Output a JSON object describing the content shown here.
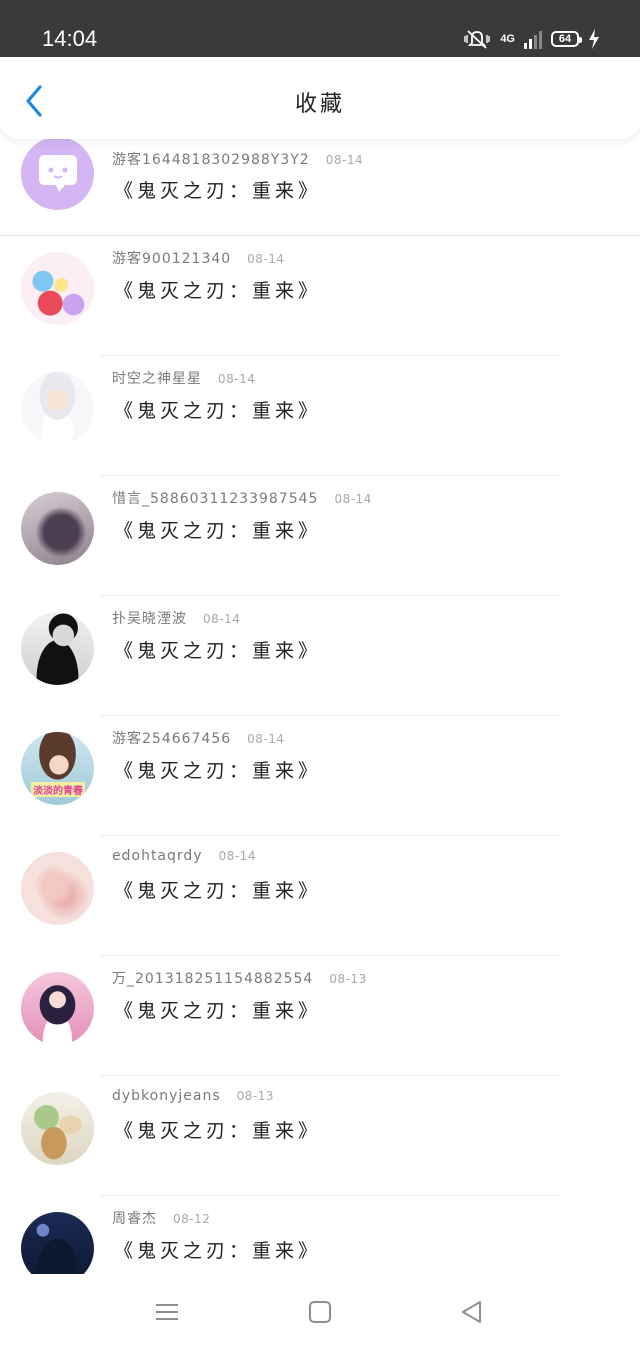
{
  "status_bar": {
    "time": "14:04",
    "network": "4G",
    "battery": "64",
    "icons": [
      "silent-vibrate-icon",
      "signal-icon",
      "battery-icon",
      "charging-icon"
    ]
  },
  "header": {
    "title": "收藏",
    "back_icon": "chevron-left-icon",
    "accent_color": "#1e88e5"
  },
  "favorites": [
    {
      "username": "游客1644818302988Y3Y2",
      "date": "08-14",
      "content": "《鬼灭之刃：重来》"
    },
    {
      "username": "游客900121340",
      "date": "08-14",
      "content": "《鬼灭之刃：重来》"
    },
    {
      "username": "时空之神星星",
      "date": "08-14",
      "content": "《鬼灭之刃：重来》"
    },
    {
      "username": "惜言_58860311233987545",
      "date": "08-14",
      "content": "《鬼灭之刃：重来》"
    },
    {
      "username": "扑吴晓湮波",
      "date": "08-14",
      "content": "《鬼灭之刃：重来》"
    },
    {
      "username": "游客254667456",
      "date": "08-14",
      "content": "《鬼灭之刃：重来》"
    },
    {
      "username": "edohtaqrdy",
      "date": "08-14",
      "content": "《鬼灭之刃：重来》"
    },
    {
      "username": "万_2013182511548825​54",
      "date": "08-13",
      "content": "《鬼灭之刃：重来》"
    },
    {
      "username": "dybkonyjeans",
      "date": "08-13",
      "content": "《鬼灭之刃：重来》"
    },
    {
      "username": "周睿杰",
      "date": "08-12",
      "content": "《鬼灭之刃：重来》"
    }
  ],
  "avatar_overlay_text": "淡淡的青春",
  "nav_bar": {
    "icons": [
      "menu-icon",
      "home-square-icon",
      "back-triangle-icon"
    ]
  }
}
